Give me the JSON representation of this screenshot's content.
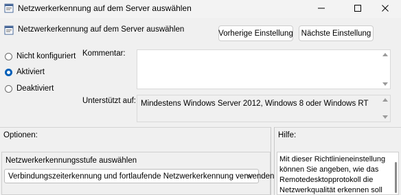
{
  "window": {
    "title": "Netzwerkerkennung auf dem Server auswählen",
    "icons": {
      "app": "policy-setting-icon",
      "minimize": "minimize-icon",
      "maximize": "maximize-icon",
      "close": "close-icon"
    }
  },
  "header": {
    "policy_name": "Netzwerkerkennung auf dem Server auswählen",
    "prev_button": "Vorherige Einstellung",
    "next_button": "Nächste Einstellung"
  },
  "state": {
    "options": [
      {
        "label": "Nicht konfiguriert",
        "checked": false
      },
      {
        "label": "Aktiviert",
        "checked": true
      },
      {
        "label": "Deaktiviert",
        "checked": false
      }
    ]
  },
  "comment": {
    "label": "Kommentar:",
    "value": ""
  },
  "supported": {
    "label": "Unterstützt auf:",
    "value": "Mindestens Windows Server 2012, Windows 8 oder Windows RT"
  },
  "options_section": {
    "label": "Optionen:",
    "field_label": "Netzwerkerkennungsstufe auswählen",
    "select_value": "Verbindungszeiterkennung und fortlaufende Netzwerkerkennung verwenden"
  },
  "help_section": {
    "label": "Hilfe:",
    "text": "Mit dieser Richtlinieneinstellung können Sie angeben, wie das Remotedesktopprotokoll die Netzwerkqualität erkennen soll"
  },
  "colors": {
    "accent": "#005fb8",
    "background": "#f0f0f0"
  }
}
